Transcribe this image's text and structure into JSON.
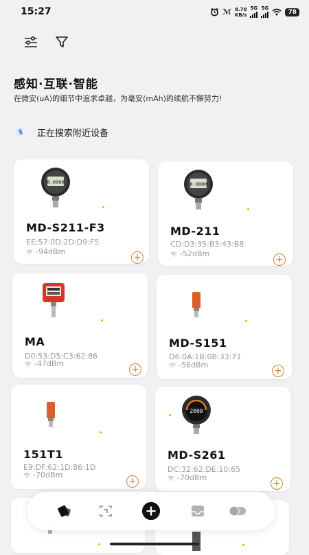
{
  "status_bar": {
    "time": "15:27",
    "net_speed_value": "8.70",
    "net_speed_unit": "KB/s",
    "sim1_label": "5G",
    "sim2_label": "5G",
    "battery": "78"
  },
  "header": {
    "title": "感知·互联·智能",
    "subtitle": "在微安(uA)的细节中追求卓越，为毫安(mAh)的续航不懈努力!"
  },
  "search": {
    "status_text": "正在搜索附近设备"
  },
  "devices": [
    {
      "name": "MD-S211-F3",
      "mac": "EE:57:0D:2D:D9:F5",
      "rssi": "-94dBm",
      "image": "digital-gauge-icon"
    },
    {
      "name": "MD-211",
      "mac": "CD:D3:35:B3:43:B8",
      "rssi": "-52dBm",
      "image": "digital-gauge-icon"
    },
    {
      "name": "MA",
      "mac": "D0:53:D5:C3:62:86",
      "rssi": "-47dBm",
      "image": "red-transmitter-icon"
    },
    {
      "name": "MD-S151",
      "mac": "D6:0A:1B:0B:33:71",
      "rssi": "-56dBm",
      "image": "orange-sensor-icon"
    },
    {
      "name": "151T1",
      "mac": "E9:DF:62:1D:86:1D",
      "rssi": "-70dBm",
      "image": "orange-sensor-icon"
    },
    {
      "name": "MD-S261",
      "mac": "DC:32:62:DE:10:65",
      "rssi": "-70dBm",
      "image": "round-display-gauge-icon"
    }
  ],
  "digital_readout": "0.0000",
  "round_readout": "2000",
  "colors": {
    "accent": "#d0822e",
    "dot": "#f0b300",
    "background": "#f1f1f3",
    "card": "#ffffff"
  },
  "bottom_nav": {
    "items": [
      "devices-icon",
      "scan-icon",
      "add-icon",
      "inbox-icon",
      "toggle-icon"
    ]
  }
}
